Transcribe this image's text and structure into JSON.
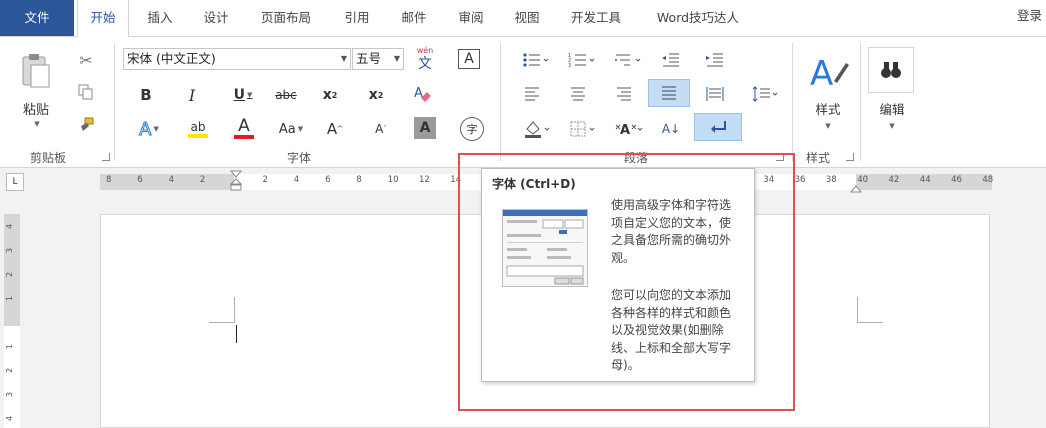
{
  "tabs": [
    {
      "label": "文件",
      "kind": "file"
    },
    {
      "label": "开始",
      "kind": "active"
    },
    {
      "label": "插入"
    },
    {
      "label": "设计"
    },
    {
      "label": "页面布局"
    },
    {
      "label": "引用"
    },
    {
      "label": "邮件"
    },
    {
      "label": "审阅"
    },
    {
      "label": "视图"
    },
    {
      "label": "开发工具"
    },
    {
      "label": "Word技巧达人"
    }
  ],
  "account": {
    "login": "登录"
  },
  "clipboard": {
    "paste": "粘贴",
    "group": "剪贴板"
  },
  "font": {
    "name": "宋体 (中文正文)",
    "size": "五号",
    "phonetic_top": "wén",
    "phonetic_bottom": "文",
    "border_char": "A",
    "bold": "B",
    "italic": "I",
    "underline": "U",
    "strike": "abc",
    "subscript": "x",
    "subscript_mark": "2",
    "superscript": "x",
    "superscript_mark": "2",
    "effects": "A",
    "highlight": "ab",
    "color": "A",
    "case": "Aa",
    "grow": "A",
    "shrink": "A",
    "shade": "A",
    "enclose": "字",
    "group": "字体"
  },
  "paragraph": {
    "group": "段落",
    "sort": "A"
  },
  "styles": {
    "label": "样式",
    "group": "样式"
  },
  "editing": {
    "label": "编辑"
  },
  "ruler": {
    "corner": "L",
    "ticks": [
      "8",
      "6",
      "4",
      "2",
      "",
      "2",
      "4",
      "6",
      "8",
      "10",
      "12",
      "14",
      "16",
      "18",
      "20",
      "22",
      "24",
      "26",
      "28",
      "30",
      "32",
      "34",
      "36",
      "38",
      "40",
      "42",
      "44",
      "46",
      "48"
    ],
    "vticks": [
      "4",
      "3",
      "2",
      "1",
      "",
      "1",
      "2",
      "3",
      "4"
    ]
  },
  "tooltip": {
    "title": "字体 (Ctrl+D)",
    "para1": [
      "使用高级字体和字符选",
      "项自定义您的文本，使",
      "之具备您所需的确切外",
      "观。"
    ],
    "para2": [
      "您可以向您的文本添加",
      "各种各样的样式和颜色",
      "以及视觉效果(如删除",
      "线、上标和全部大写字",
      "母)。"
    ]
  },
  "colors": {
    "file_tab": "#2b579a",
    "accent_blue": "#2b579a",
    "font_color_red": "#e02020",
    "highlight": "#c5dcf5",
    "annotation_red": "#e05050"
  }
}
